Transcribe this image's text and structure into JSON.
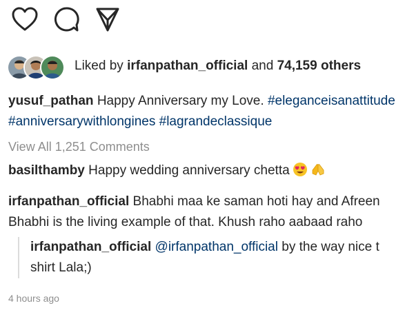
{
  "actions": {
    "like_icon": "heart-outline-icon",
    "comment_icon": "comment-bubble-icon",
    "share_icon": "paper-plane-icon"
  },
  "likes": {
    "prefix": "Liked by",
    "first_user": "irfanpathan_official",
    "connector": "and",
    "others": "74,159 others"
  },
  "caption": {
    "username": "yusuf_pathan",
    "text": "Happy Anniversary my Love.",
    "hashtag_1": "#eleganceisanattitude",
    "hashtag_2": "#anniversarywithlongines",
    "hashtag_3": "#lagrandeclassique"
  },
  "comments_link": "View All 1,251 Comments",
  "comments": [
    {
      "username": "basilthamby",
      "text": "Happy wedding anniversary chetta",
      "emojis": [
        "heart-eyes-emoji",
        "folded-hands-emoji"
      ]
    },
    {
      "username": "irfanpathan_official",
      "text_line_1": "Bhabhi maa ke saman hoti hay and Afreen",
      "text_line_2": "Bhabhi  is the living example of that. Khush raho aabaad raho"
    }
  ],
  "reply": {
    "username": "irfanpathan_official",
    "mention": "@irfanpathan_official",
    "text_line_1": "by the way nice t",
    "text_line_2": "shirt Lala;)"
  },
  "timestamp": "4 hours ago",
  "colors": {
    "text": "#262626",
    "hashtag": "#003569",
    "muted": "#8e8e8e"
  }
}
